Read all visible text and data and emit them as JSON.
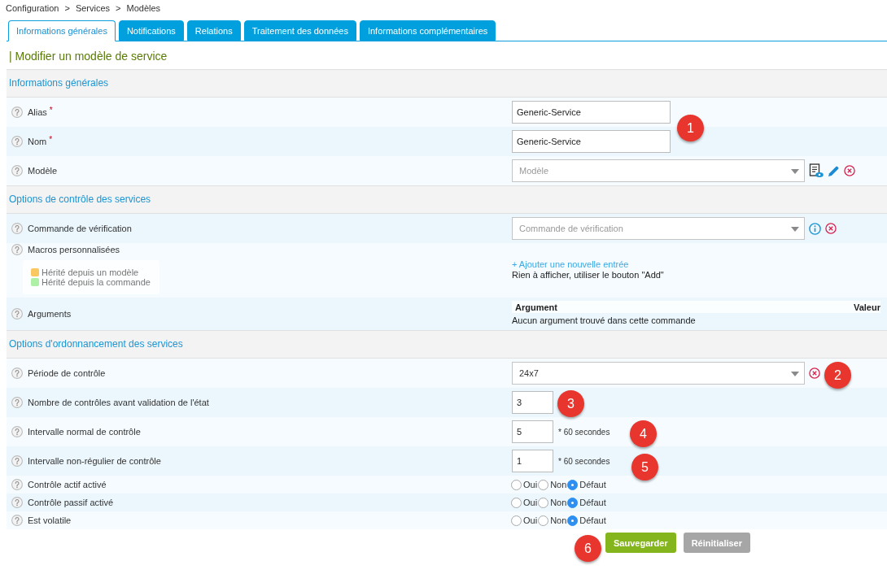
{
  "breadcrumb": {
    "items": [
      "Configuration",
      "Services",
      "Modèles"
    ],
    "separator": ">"
  },
  "tabs": [
    {
      "label": "Informations générales",
      "selected": true
    },
    {
      "label": "Notifications",
      "selected": false
    },
    {
      "label": "Relations",
      "selected": false
    },
    {
      "label": "Traitement des données",
      "selected": false
    },
    {
      "label": "Informations complémentaires",
      "selected": false
    }
  ],
  "page_title": "| Modifier un modèle de service",
  "sections": [
    {
      "title": "Informations générales",
      "rows": [
        {
          "kind": "text",
          "label": "Alias",
          "required_mark": "*",
          "value": "Generic-Service"
        },
        {
          "kind": "text",
          "label": "Nom",
          "required_mark": "*",
          "value": "Generic-Service"
        },
        {
          "kind": "select",
          "label": "Modèle",
          "placeholder": "Modèle",
          "actions": [
            {
              "kind": "view"
            },
            {
              "kind": "edit"
            },
            {
              "kind": "clear"
            }
          ]
        }
      ]
    },
    {
      "title": "Options de contrôle des services",
      "rows": [
        {
          "kind": "select",
          "label": "Commande de vérification",
          "placeholder": "Commande de vérification",
          "actions": [
            {
              "kind": "info"
            },
            {
              "kind": "clear"
            }
          ]
        },
        {
          "kind": "macros",
          "label": "Macros personnalisées",
          "legend": [
            {
              "label": "Hérité depuis un modèle",
              "color": "#fbc760"
            },
            {
              "label": "Hérité depuis la commande",
              "color": "#aef0a6"
            }
          ],
          "add_link": "+ Ajouter une nouvelle entrée",
          "empty_text": "Rien à afficher, utiliser le bouton \"Add\""
        },
        {
          "kind": "arguments",
          "label": "Arguments",
          "columns": [
            "Argument",
            "Valeur"
          ],
          "empty_text": "Aucun argument trouvé dans cette commande"
        }
      ]
    },
    {
      "title": "Options d'ordonnancement des services",
      "rows": [
        {
          "kind": "select",
          "label": "Période de contrôle",
          "value": "24x7",
          "actions": [
            {
              "kind": "clear"
            }
          ]
        },
        {
          "kind": "number",
          "label": "Nombre de contrôles avant validation de l'état",
          "value": "3"
        },
        {
          "kind": "number",
          "label": "Intervalle normal de contrôle",
          "value": "5",
          "unit": "* 60 secondes"
        },
        {
          "kind": "number",
          "label": "Intervalle non-régulier de contrôle",
          "value": "1",
          "unit": "* 60 secondes"
        },
        {
          "kind": "radio",
          "label": "Contrôle actif activé",
          "options": [
            {
              "label": "Oui",
              "selected": false
            },
            {
              "label": "Non",
              "selected": false
            },
            {
              "label": "Défaut",
              "selected": true
            }
          ]
        },
        {
          "kind": "radio",
          "label": "Contrôle passif activé",
          "options": [
            {
              "label": "Oui",
              "selected": false
            },
            {
              "label": "Non",
              "selected": false
            },
            {
              "label": "Défaut",
              "selected": true
            }
          ]
        },
        {
          "kind": "radio",
          "label": "Est volatile",
          "options": [
            {
              "label": "Oui",
              "selected": false
            },
            {
              "label": "Non",
              "selected": false
            },
            {
              "label": "Défaut",
              "selected": true
            }
          ]
        }
      ]
    }
  ],
  "buttons": [
    {
      "kind": "primary",
      "label": "Sauvegarder"
    },
    {
      "kind": "secondary",
      "label": "Réinitialiser"
    }
  ],
  "callouts": [
    "1",
    "2",
    "3",
    "4",
    "5",
    "6"
  ]
}
